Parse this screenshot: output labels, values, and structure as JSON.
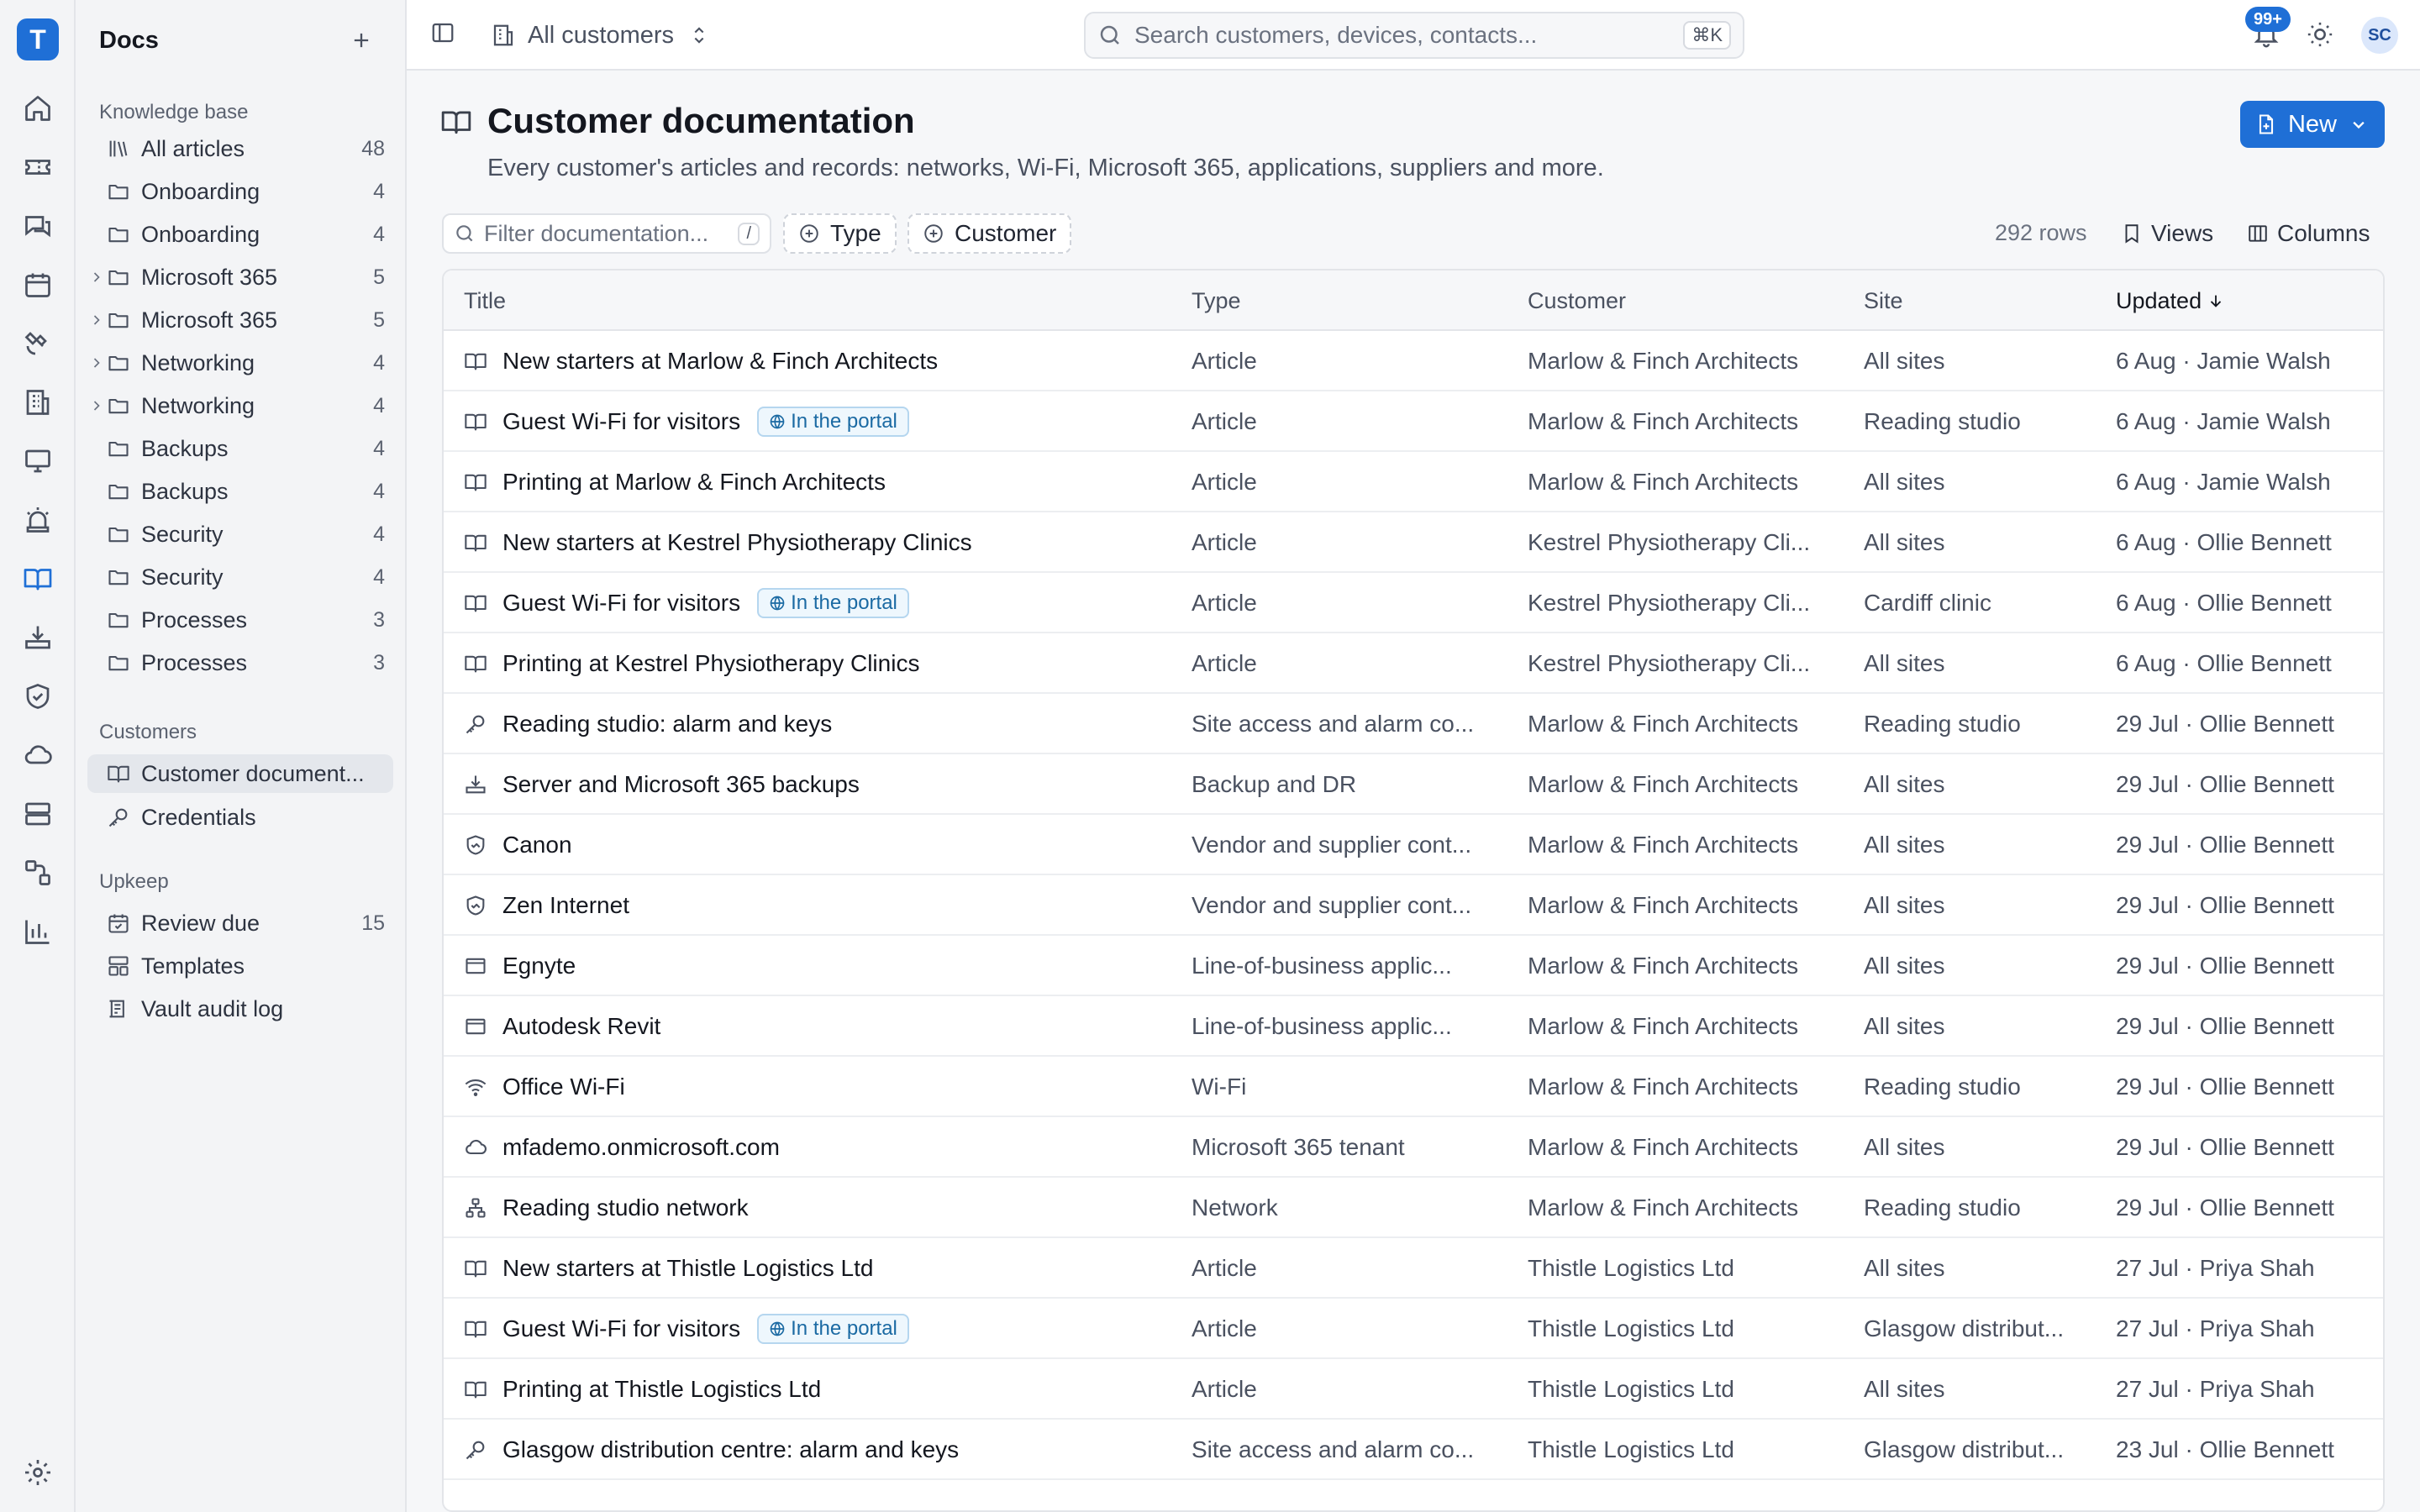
{
  "app": {
    "logo_letter": "T"
  },
  "sidebar": {
    "title": "Docs",
    "knowledge_base_label": "Knowledge base",
    "kb_items": [
      {
        "label": "All articles",
        "count": "48",
        "icon": "library-icon",
        "chevron": false
      },
      {
        "label": "Onboarding",
        "count": "4",
        "icon": "folder-icon",
        "chevron": false
      },
      {
        "label": "Onboarding",
        "count": "4",
        "icon": "folder-icon",
        "chevron": false
      },
      {
        "label": "Microsoft 365",
        "count": "5",
        "icon": "folder-icon",
        "chevron": true
      },
      {
        "label": "Microsoft 365",
        "count": "5",
        "icon": "folder-icon",
        "chevron": true
      },
      {
        "label": "Networking",
        "count": "4",
        "icon": "folder-icon",
        "chevron": true
      },
      {
        "label": "Networking",
        "count": "4",
        "icon": "folder-icon",
        "chevron": true
      },
      {
        "label": "Backups",
        "count": "4",
        "icon": "folder-icon",
        "chevron": false
      },
      {
        "label": "Backups",
        "count": "4",
        "icon": "folder-icon",
        "chevron": false
      },
      {
        "label": "Security",
        "count": "4",
        "icon": "folder-icon",
        "chevron": false
      },
      {
        "label": "Security",
        "count": "4",
        "icon": "folder-icon",
        "chevron": false
      },
      {
        "label": "Processes",
        "count": "3",
        "icon": "folder-icon",
        "chevron": false
      },
      {
        "label": "Processes",
        "count": "3",
        "icon": "folder-icon",
        "chevron": false
      }
    ],
    "customers_label": "Customers",
    "customers_items": [
      {
        "label": "Customer document...",
        "icon": "book-icon",
        "active": true
      },
      {
        "label": "Credentials",
        "icon": "key-icon",
        "active": false
      }
    ],
    "upkeep_label": "Upkeep",
    "upkeep_items": [
      {
        "label": "Review due",
        "count": "15",
        "icon": "calendar-check-icon"
      },
      {
        "label": "Templates",
        "icon": "template-icon"
      },
      {
        "label": "Vault audit log",
        "icon": "audit-log-icon"
      }
    ]
  },
  "topbar": {
    "customer_scope": "All customers",
    "search_placeholder": "Search customers, devices, contacts...",
    "search_shortcut": "⌘K",
    "notification_badge": "99+",
    "avatar_initials": "SC"
  },
  "page": {
    "title": "Customer documentation",
    "subtitle": "Every customer's articles and records: networks, Wi-Fi, Microsoft 365, applications, suppliers and more.",
    "new_button": "New"
  },
  "toolbar": {
    "filter_placeholder": "Filter documentation...",
    "filter_shortcut": "/",
    "chip_type": "Type",
    "chip_customer": "Customer",
    "rows_count": "292 rows",
    "views_label": "Views",
    "columns_label": "Columns"
  },
  "table": {
    "columns": {
      "title": "Title",
      "type": "Type",
      "customer": "Customer",
      "site": "Site",
      "updated": "Updated"
    },
    "portal_badge": "In the portal",
    "rows": [
      {
        "icon": "book-icon",
        "title": "New starters at Marlow & Finch Architects",
        "portal": false,
        "type": "Article",
        "customer": "Marlow & Finch Architects",
        "site": "All sites",
        "updated": "6 Aug · Jamie Walsh"
      },
      {
        "icon": "book-icon",
        "title": "Guest Wi-Fi for visitors",
        "portal": true,
        "type": "Article",
        "customer": "Marlow & Finch Architects",
        "site": "Reading studio",
        "updated": "6 Aug · Jamie Walsh"
      },
      {
        "icon": "book-icon",
        "title": "Printing at Marlow & Finch Architects",
        "portal": false,
        "type": "Article",
        "customer": "Marlow & Finch Architects",
        "site": "All sites",
        "updated": "6 Aug · Jamie Walsh"
      },
      {
        "icon": "book-icon",
        "title": "New starters at Kestrel Physiotherapy Clinics",
        "portal": false,
        "type": "Article",
        "customer": "Kestrel Physiotherapy Cli...",
        "site": "All sites",
        "updated": "6 Aug · Ollie Bennett"
      },
      {
        "icon": "book-icon",
        "title": "Guest Wi-Fi for visitors",
        "portal": true,
        "type": "Article",
        "customer": "Kestrel Physiotherapy Cli...",
        "site": "Cardiff clinic",
        "updated": "6 Aug · Ollie Bennett"
      },
      {
        "icon": "book-icon",
        "title": "Printing at Kestrel Physiotherapy Clinics",
        "portal": false,
        "type": "Article",
        "customer": "Kestrel Physiotherapy Cli...",
        "site": "All sites",
        "updated": "6 Aug · Ollie Bennett"
      },
      {
        "icon": "key-icon",
        "title": "Reading studio: alarm and keys",
        "portal": false,
        "type": "Site access and alarm co...",
        "customer": "Marlow & Finch Architects",
        "site": "Reading studio",
        "updated": "29 Jul · Ollie Bennett"
      },
      {
        "icon": "backup-icon",
        "title": "Server and Microsoft 365 backups",
        "portal": false,
        "type": "Backup and DR",
        "customer": "Marlow & Finch Architects",
        "site": "All sites",
        "updated": "29 Jul · Ollie Bennett"
      },
      {
        "icon": "handshake-icon",
        "title": "Canon",
        "portal": false,
        "type": "Vendor and supplier cont...",
        "customer": "Marlow & Finch Architects",
        "site": "All sites",
        "updated": "29 Jul · Ollie Bennett"
      },
      {
        "icon": "handshake-icon",
        "title": "Zen Internet",
        "portal": false,
        "type": "Vendor and supplier cont...",
        "customer": "Marlow & Finch Architects",
        "site": "All sites",
        "updated": "29 Jul · Ollie Bennett"
      },
      {
        "icon": "app-window-icon",
        "title": "Egnyte",
        "portal": false,
        "type": "Line-of-business applic...",
        "customer": "Marlow & Finch Architects",
        "site": "All sites",
        "updated": "29 Jul · Ollie Bennett"
      },
      {
        "icon": "app-window-icon",
        "title": "Autodesk Revit",
        "portal": false,
        "type": "Line-of-business applic...",
        "customer": "Marlow & Finch Architects",
        "site": "All sites",
        "updated": "29 Jul · Ollie Bennett"
      },
      {
        "icon": "wifi-icon",
        "title": "Office Wi-Fi",
        "portal": false,
        "type": "Wi-Fi",
        "customer": "Marlow & Finch Architects",
        "site": "Reading studio",
        "updated": "29 Jul · Ollie Bennett"
      },
      {
        "icon": "cloud-icon",
        "title": "mfademo.onmicrosoft.com",
        "portal": false,
        "type": "Microsoft 365 tenant",
        "customer": "Marlow & Finch Architects",
        "site": "All sites",
        "updated": "29 Jul · Ollie Bennett"
      },
      {
        "icon": "network-icon",
        "title": "Reading studio network",
        "portal": false,
        "type": "Network",
        "customer": "Marlow & Finch Architects",
        "site": "Reading studio",
        "updated": "29 Jul · Ollie Bennett"
      },
      {
        "icon": "book-icon",
        "title": "New starters at Thistle Logistics Ltd",
        "portal": false,
        "type": "Article",
        "customer": "Thistle Logistics Ltd",
        "site": "All sites",
        "updated": "27 Jul · Priya Shah"
      },
      {
        "icon": "book-icon",
        "title": "Guest Wi-Fi for visitors",
        "portal": true,
        "type": "Article",
        "customer": "Thistle Logistics Ltd",
        "site": "Glasgow distribut...",
        "updated": "27 Jul · Priya Shah"
      },
      {
        "icon": "book-icon",
        "title": "Printing at Thistle Logistics Ltd",
        "portal": false,
        "type": "Article",
        "customer": "Thistle Logistics Ltd",
        "site": "All sites",
        "updated": "27 Jul · Priya Shah"
      },
      {
        "icon": "key-icon",
        "title": "Glasgow distribution centre: alarm and keys",
        "portal": false,
        "type": "Site access and alarm co...",
        "customer": "Thistle Logistics Ltd",
        "site": "Glasgow distribut...",
        "updated": "23 Jul · Ollie Bennett"
      }
    ]
  },
  "colors": {
    "accent": "#1f6fd6",
    "portal_badge_bg": "#eef7fd",
    "portal_badge_text": "#1b6aa3"
  }
}
